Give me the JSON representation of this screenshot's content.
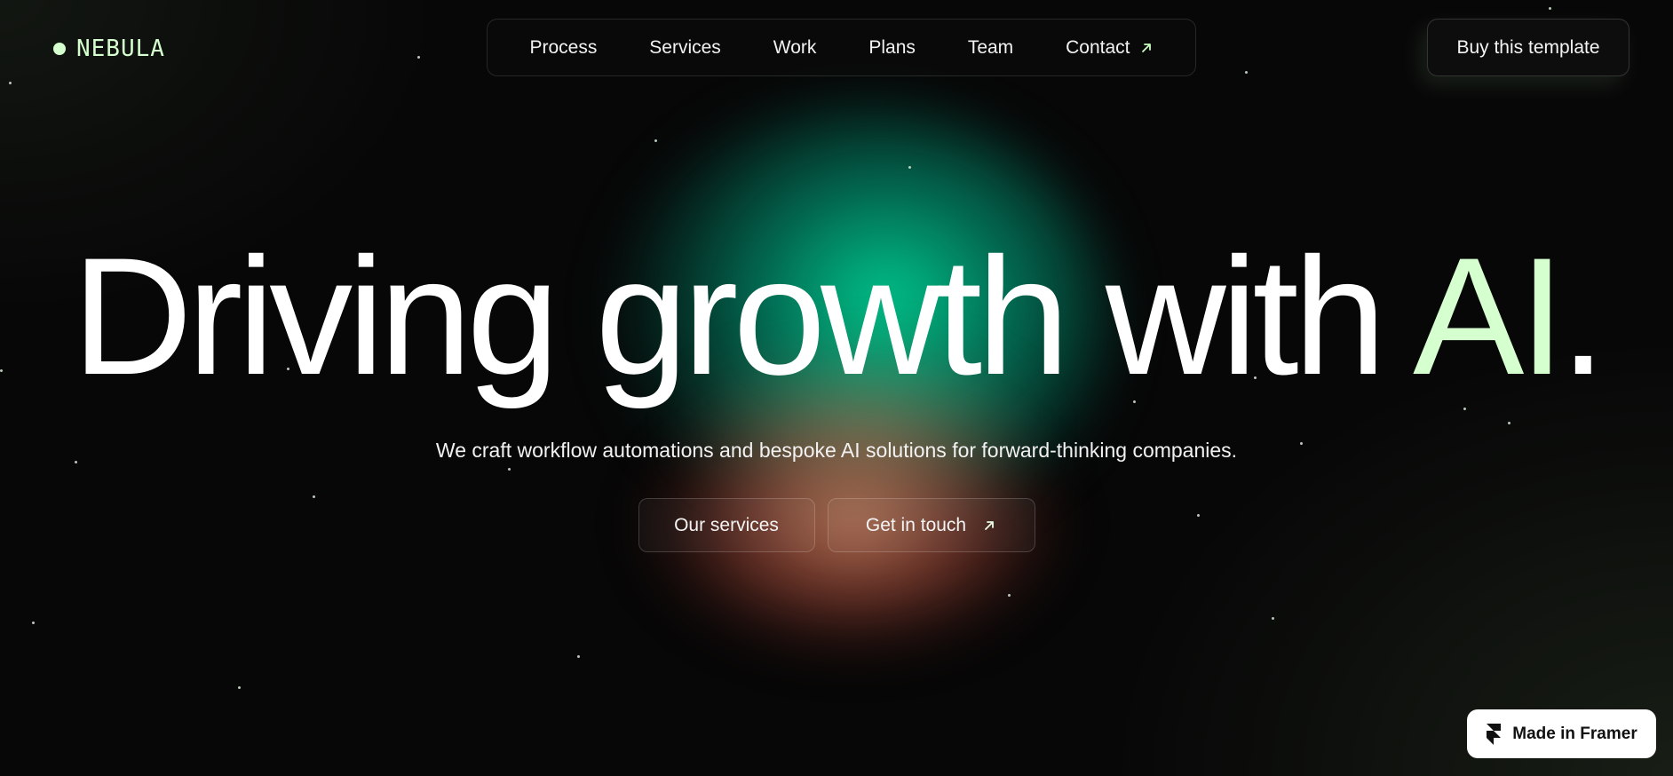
{
  "brand": {
    "name": "NEBULA",
    "accent_color": "#d6ffcf"
  },
  "nav": {
    "items": [
      {
        "label": "Process"
      },
      {
        "label": "Services"
      },
      {
        "label": "Work"
      },
      {
        "label": "Plans"
      },
      {
        "label": "Team"
      },
      {
        "label": "Contact",
        "icon": "arrow-up-right-icon"
      }
    ]
  },
  "header": {
    "buy_label": "Buy this template"
  },
  "hero": {
    "headline_main": "Driving growth with ",
    "headline_accent": "AI",
    "headline_end": ".",
    "subtitle": "We craft workflow automations and bespoke AI solutions for forward-thinking companies.",
    "cta_primary": "Our services",
    "cta_secondary": "Get in touch",
    "cta_secondary_icon": "arrow-up-right-icon"
  },
  "badge": {
    "label": "Made in Framer",
    "icon": "framer-logo-icon"
  },
  "colors": {
    "background": "#070707",
    "glow_green": "#00d696",
    "glow_peach": "#eb966e",
    "text": "#ffffff"
  }
}
